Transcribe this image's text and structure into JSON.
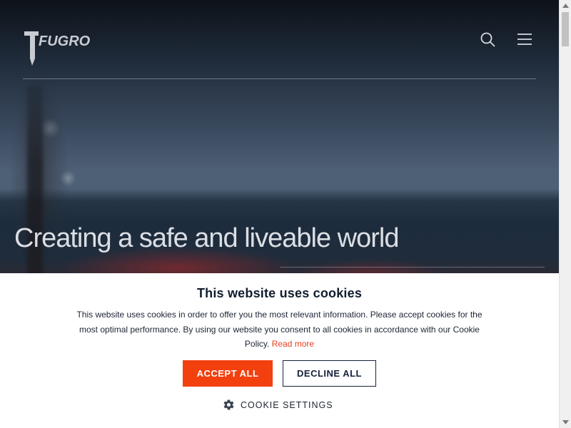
{
  "header": {
    "logo_text": "FUGRO",
    "search_icon": "search-icon",
    "menu_icon": "hamburger-menu-icon"
  },
  "hero": {
    "title": "Creating a safe and liveable world"
  },
  "cookie_banner": {
    "title": "This website uses cookies",
    "body": "This website uses cookies in order to offer you the most relevant information. Please accept cookies for the most optimal performance. By using our website you consent to all cookies in accordance with our Cookie Policy.",
    "read_more": "Read more",
    "accept_label": "ACCEPT ALL",
    "decline_label": "DECLINE ALL",
    "settings_label": "COOKIE SETTINGS",
    "settings_icon": "gear-icon"
  },
  "colors": {
    "accent": "#f2400f",
    "navy": "#152238",
    "link": "#e8401c"
  }
}
